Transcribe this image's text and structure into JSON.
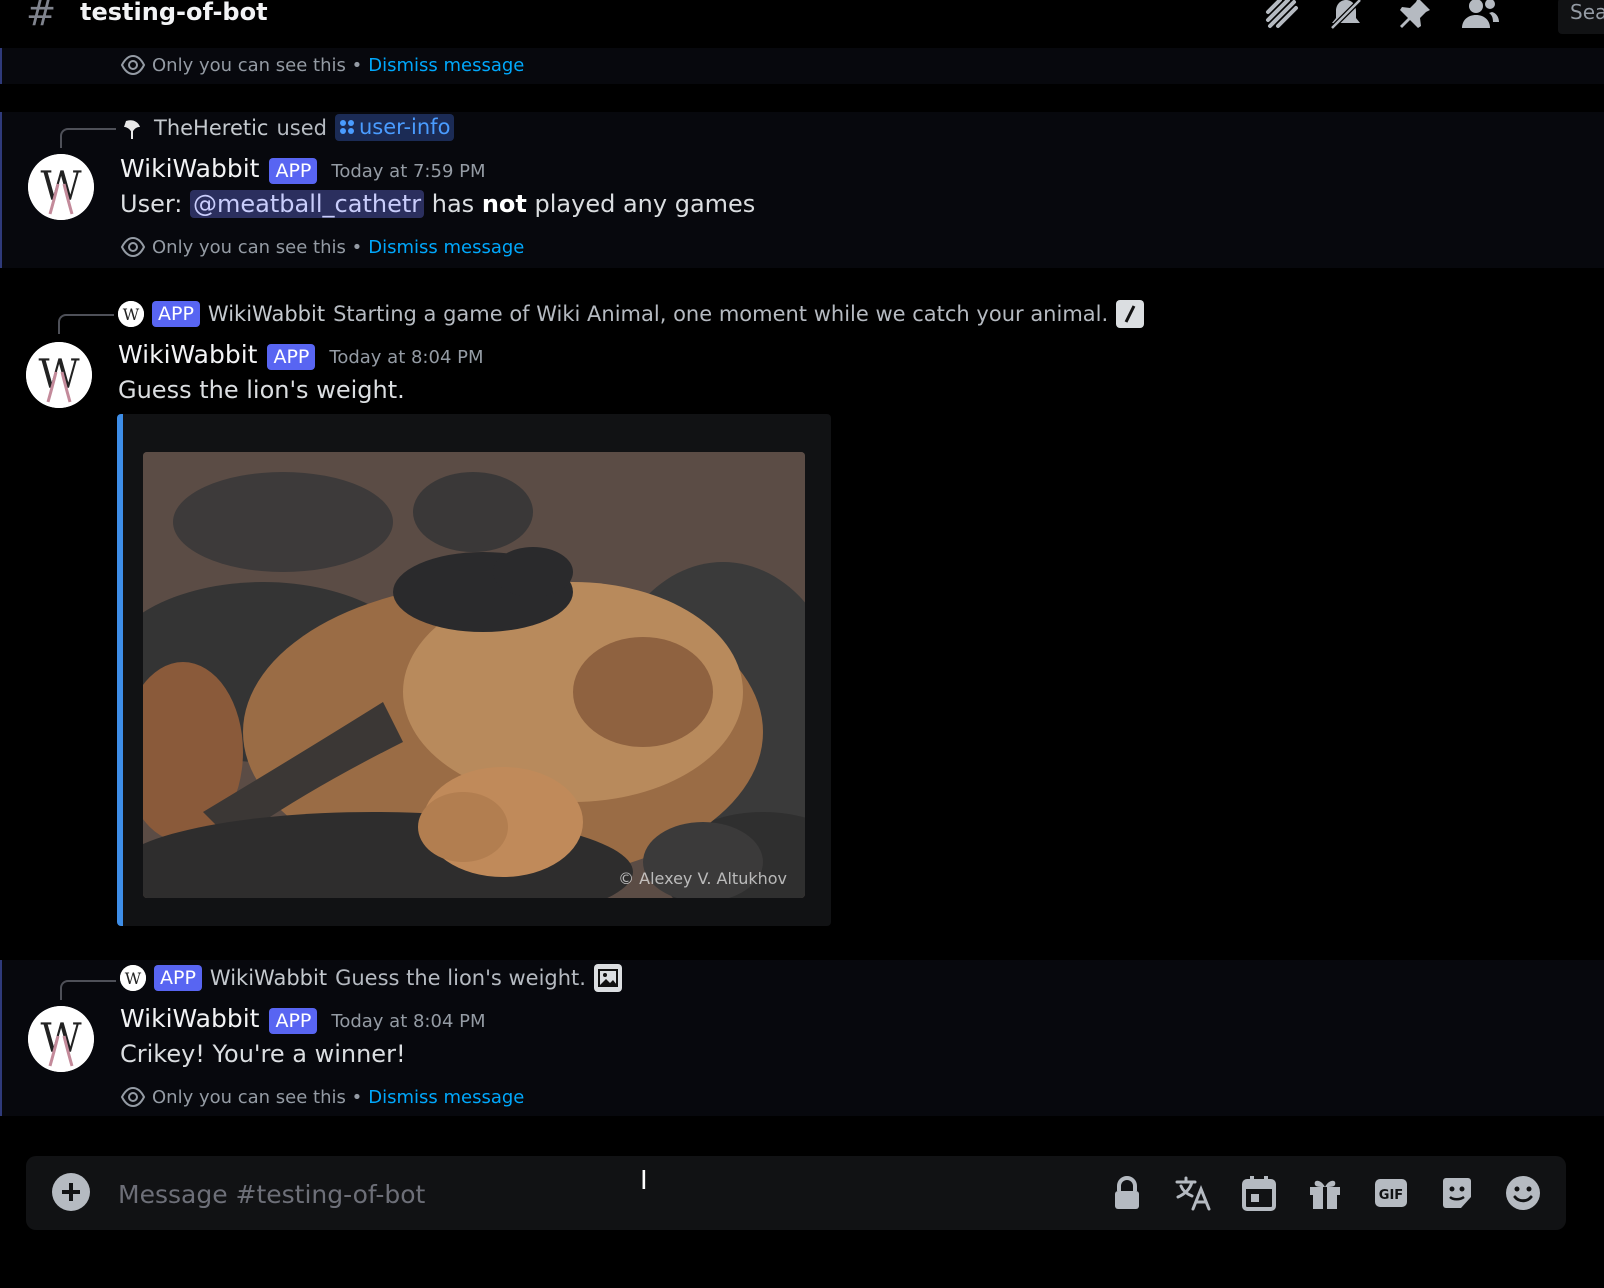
{
  "topbar": {
    "channel_name": "testing-of-bot",
    "search_label": "Sea"
  },
  "ephemeral_note": {
    "text": "Only you can see this •",
    "dismiss": "Dismiss message"
  },
  "messages": [
    {
      "ref_user": "TheHeretic",
      "ref_used": "used",
      "ref_command": "user-info",
      "author": "WikiWabbit",
      "badge": "APP",
      "time": "Today at 7:59 PM",
      "content_prefix": "User:",
      "mention": "@meatball_cathetr",
      "content_mid": "has",
      "content_bold": "not",
      "content_suffix": "played any games"
    },
    {
      "ref_badge": "APP",
      "ref_user": "WikiWabbit",
      "ref_text": "Starting a game of Wiki Animal, one moment while we catch your animal.",
      "author": "WikiWabbit",
      "badge": "APP",
      "time": "Today at 8:04 PM",
      "content": "Guess the lion's weight.",
      "embed_credit": "© Alexey V. Altukhov"
    },
    {
      "ref_badge": "APP",
      "ref_user": "WikiWabbit",
      "ref_text": "Guess the lion's weight.",
      "author": "WikiWabbit",
      "badge": "APP",
      "time": "Today at 8:04 PM",
      "content": "Crikey! You're a winner!"
    }
  ],
  "composer": {
    "placeholder": "Message #testing-of-bot",
    "gif_label": "GIF"
  },
  "icons": {
    "threads": "threads-icon",
    "notifications": "bell-muted-icon",
    "pins": "pin-icon",
    "members": "members-icon",
    "add": "plus-circle-icon",
    "lock": "lock-icon",
    "translate": "translate-icon",
    "schedule": "calendar-icon",
    "gift": "gift-icon",
    "gif": "gif-icon",
    "sticker": "sticker-icon",
    "emoji": "emoji-icon"
  }
}
